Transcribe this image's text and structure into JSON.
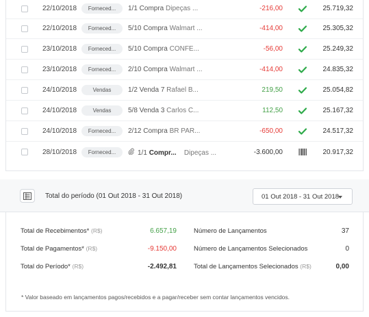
{
  "rows": [
    {
      "date": "22/10/2018",
      "type": "Forneced...",
      "desc_prefix": "1/1 Compra",
      "desc_payee": "Dipeças ...",
      "value": "-216,00",
      "value_kind": "neg",
      "status": "check",
      "balance": "25.719,32"
    },
    {
      "date": "22/10/2018",
      "type": "Forneced...",
      "desc_prefix": "5/10 Compra",
      "desc_payee": "Walmart ...",
      "value": "-414,00",
      "value_kind": "neg",
      "status": "check",
      "balance": "25.305,32"
    },
    {
      "date": "23/10/2018",
      "type": "Forneced...",
      "desc_prefix": "5/10 Compra",
      "desc_payee": "CONFE...",
      "value": "-56,00",
      "value_kind": "neg",
      "status": "check",
      "balance": "25.249,32"
    },
    {
      "date": "23/10/2018",
      "type": "Forneced...",
      "desc_prefix": "2/10 Compra",
      "desc_payee": "Walmart ...",
      "value": "-414,00",
      "value_kind": "neg",
      "status": "check",
      "balance": "24.835,32"
    },
    {
      "date": "24/10/2018",
      "type": "Vendas",
      "desc_prefix": "1/2 Venda 7",
      "desc_payee": "Rafael B...",
      "value": "219,50",
      "value_kind": "pos",
      "status": "check",
      "balance": "25.054,82"
    },
    {
      "date": "24/10/2018",
      "type": "Vendas",
      "desc_prefix": "5/8 Venda 3",
      "desc_payee": "Carlos C...",
      "value": "112,50",
      "value_kind": "pos",
      "status": "check",
      "balance": "25.167,32"
    },
    {
      "date": "24/10/2018",
      "type": "Forneced...",
      "desc_prefix": "2/12 Compra",
      "desc_payee": "BR PAR...",
      "value": "-650,00",
      "value_kind": "neg",
      "status": "check",
      "balance": "24.517,32"
    },
    {
      "date": "28/10/2018",
      "type": "Forneced...",
      "desc_prefix": "1/1",
      "desc_bold": "Compr...",
      "desc_payee": "Dipeças ...",
      "value": "-3.600,00",
      "value_kind": "neutral",
      "status": "barcode",
      "balance": "20.917,32",
      "attachment": true
    }
  ],
  "period": {
    "title": "Total do período (01 Out 2018 - 31 Out 2018)",
    "select_value": "01 Out 2018 - 31 Out 2018"
  },
  "totals": {
    "receb_label": "Total de Recebimentos*",
    "receb_value": "6.657,19",
    "pag_label": "Total de Pagamentos*",
    "pag_value": "-9.150,00",
    "periodo_label": "Total do Período*",
    "periodo_value": "-2.492,81",
    "unit": "(R$)",
    "num_lanc_label": "Número de Lançamentos",
    "num_lanc_value": "37",
    "num_sel_label": "Número de Lançamentos Selecionados",
    "num_sel_value": "0",
    "total_sel_label": "Total de Lançamentos Selecionados",
    "total_sel_value": "0,00",
    "note": "* Valor baseado em lançamentos pagos/recebidos e a pagar/receber sem contar lançamentos vencidos."
  },
  "colors": {
    "negative": "#e53935",
    "positive": "#43a047",
    "check": "#2eaa4a"
  }
}
